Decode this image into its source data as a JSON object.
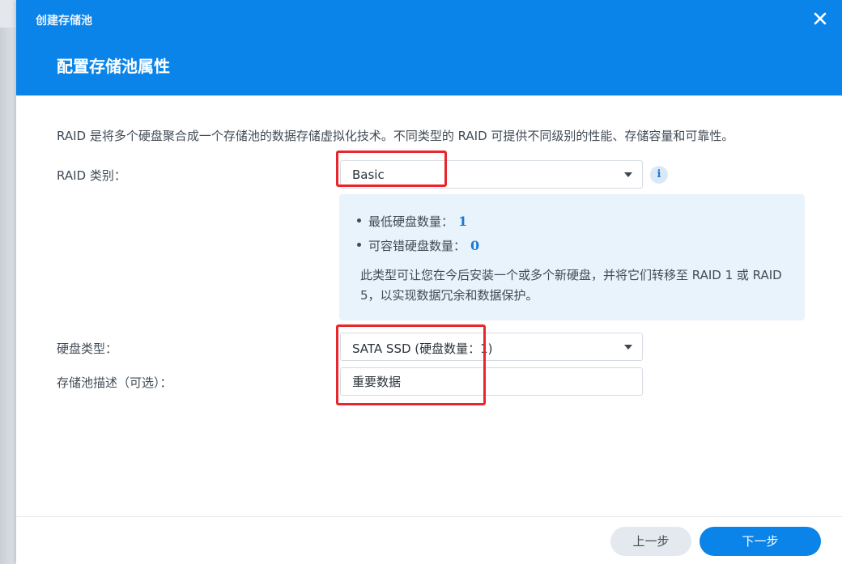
{
  "window": {
    "app_title": "创建存储池",
    "step_title": "配置存储池属性"
  },
  "main": {
    "description": "RAID 是将多个硬盘聚合成一个存储池的数据存储虚拟化技术。不同类型的 RAID 可提供不同级别的性能、存储容量和可靠性。",
    "raid_type": {
      "label": "RAID 类别：",
      "value": "Basic"
    },
    "raid_info": {
      "min_disks_label": "最低硬盘数量：",
      "min_disks_value": "1",
      "fault_tolerance_label": "可容错硬盘数量：",
      "fault_tolerance_value": "0",
      "note": "此类型可让您在今后安装一个或多个新硬盘，并将它们转移至 RAID 1 或 RAID 5，以实现数据冗余和数据保护。"
    },
    "disk_type": {
      "label": "硬盘类型：",
      "value": "SATA SSD (硬盘数量：1)"
    },
    "pool_description": {
      "label": "存储池描述（可选）：",
      "value": "重要数据"
    }
  },
  "footer": {
    "back_label": "上一步",
    "next_label": "下一步"
  },
  "colors": {
    "header_blue": "#0a84e8",
    "highlight_red": "#e8262b",
    "info_bg": "#e9f3fc",
    "accent_number": "#1a7bd5"
  },
  "icons": {
    "close": "close-icon",
    "info": "info-icon",
    "dropdown": "chevron-down-icon"
  }
}
